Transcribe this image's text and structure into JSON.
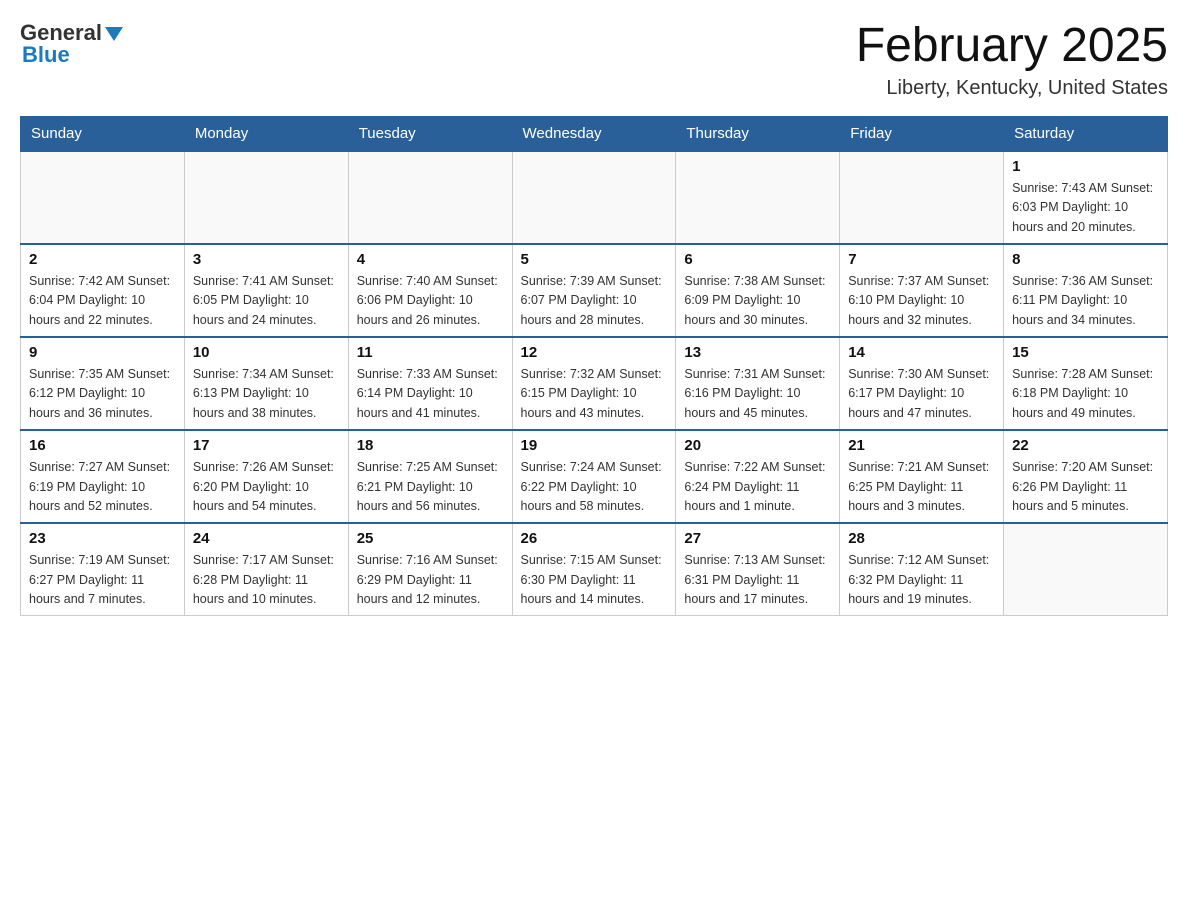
{
  "header": {
    "logo_general": "General",
    "logo_blue": "Blue",
    "month_title": "February 2025",
    "location": "Liberty, Kentucky, United States"
  },
  "days_of_week": [
    "Sunday",
    "Monday",
    "Tuesday",
    "Wednesday",
    "Thursday",
    "Friday",
    "Saturday"
  ],
  "weeks": [
    {
      "days": [
        {
          "number": "",
          "info": ""
        },
        {
          "number": "",
          "info": ""
        },
        {
          "number": "",
          "info": ""
        },
        {
          "number": "",
          "info": ""
        },
        {
          "number": "",
          "info": ""
        },
        {
          "number": "",
          "info": ""
        },
        {
          "number": "1",
          "info": "Sunrise: 7:43 AM\nSunset: 6:03 PM\nDaylight: 10 hours and 20 minutes."
        }
      ]
    },
    {
      "days": [
        {
          "number": "2",
          "info": "Sunrise: 7:42 AM\nSunset: 6:04 PM\nDaylight: 10 hours and 22 minutes."
        },
        {
          "number": "3",
          "info": "Sunrise: 7:41 AM\nSunset: 6:05 PM\nDaylight: 10 hours and 24 minutes."
        },
        {
          "number": "4",
          "info": "Sunrise: 7:40 AM\nSunset: 6:06 PM\nDaylight: 10 hours and 26 minutes."
        },
        {
          "number": "5",
          "info": "Sunrise: 7:39 AM\nSunset: 6:07 PM\nDaylight: 10 hours and 28 minutes."
        },
        {
          "number": "6",
          "info": "Sunrise: 7:38 AM\nSunset: 6:09 PM\nDaylight: 10 hours and 30 minutes."
        },
        {
          "number": "7",
          "info": "Sunrise: 7:37 AM\nSunset: 6:10 PM\nDaylight: 10 hours and 32 minutes."
        },
        {
          "number": "8",
          "info": "Sunrise: 7:36 AM\nSunset: 6:11 PM\nDaylight: 10 hours and 34 minutes."
        }
      ]
    },
    {
      "days": [
        {
          "number": "9",
          "info": "Sunrise: 7:35 AM\nSunset: 6:12 PM\nDaylight: 10 hours and 36 minutes."
        },
        {
          "number": "10",
          "info": "Sunrise: 7:34 AM\nSunset: 6:13 PM\nDaylight: 10 hours and 38 minutes."
        },
        {
          "number": "11",
          "info": "Sunrise: 7:33 AM\nSunset: 6:14 PM\nDaylight: 10 hours and 41 minutes."
        },
        {
          "number": "12",
          "info": "Sunrise: 7:32 AM\nSunset: 6:15 PM\nDaylight: 10 hours and 43 minutes."
        },
        {
          "number": "13",
          "info": "Sunrise: 7:31 AM\nSunset: 6:16 PM\nDaylight: 10 hours and 45 minutes."
        },
        {
          "number": "14",
          "info": "Sunrise: 7:30 AM\nSunset: 6:17 PM\nDaylight: 10 hours and 47 minutes."
        },
        {
          "number": "15",
          "info": "Sunrise: 7:28 AM\nSunset: 6:18 PM\nDaylight: 10 hours and 49 minutes."
        }
      ]
    },
    {
      "days": [
        {
          "number": "16",
          "info": "Sunrise: 7:27 AM\nSunset: 6:19 PM\nDaylight: 10 hours and 52 minutes."
        },
        {
          "number": "17",
          "info": "Sunrise: 7:26 AM\nSunset: 6:20 PM\nDaylight: 10 hours and 54 minutes."
        },
        {
          "number": "18",
          "info": "Sunrise: 7:25 AM\nSunset: 6:21 PM\nDaylight: 10 hours and 56 minutes."
        },
        {
          "number": "19",
          "info": "Sunrise: 7:24 AM\nSunset: 6:22 PM\nDaylight: 10 hours and 58 minutes."
        },
        {
          "number": "20",
          "info": "Sunrise: 7:22 AM\nSunset: 6:24 PM\nDaylight: 11 hours and 1 minute."
        },
        {
          "number": "21",
          "info": "Sunrise: 7:21 AM\nSunset: 6:25 PM\nDaylight: 11 hours and 3 minutes."
        },
        {
          "number": "22",
          "info": "Sunrise: 7:20 AM\nSunset: 6:26 PM\nDaylight: 11 hours and 5 minutes."
        }
      ]
    },
    {
      "days": [
        {
          "number": "23",
          "info": "Sunrise: 7:19 AM\nSunset: 6:27 PM\nDaylight: 11 hours and 7 minutes."
        },
        {
          "number": "24",
          "info": "Sunrise: 7:17 AM\nSunset: 6:28 PM\nDaylight: 11 hours and 10 minutes."
        },
        {
          "number": "25",
          "info": "Sunrise: 7:16 AM\nSunset: 6:29 PM\nDaylight: 11 hours and 12 minutes."
        },
        {
          "number": "26",
          "info": "Sunrise: 7:15 AM\nSunset: 6:30 PM\nDaylight: 11 hours and 14 minutes."
        },
        {
          "number": "27",
          "info": "Sunrise: 7:13 AM\nSunset: 6:31 PM\nDaylight: 11 hours and 17 minutes."
        },
        {
          "number": "28",
          "info": "Sunrise: 7:12 AM\nSunset: 6:32 PM\nDaylight: 11 hours and 19 minutes."
        },
        {
          "number": "",
          "info": ""
        }
      ]
    }
  ]
}
